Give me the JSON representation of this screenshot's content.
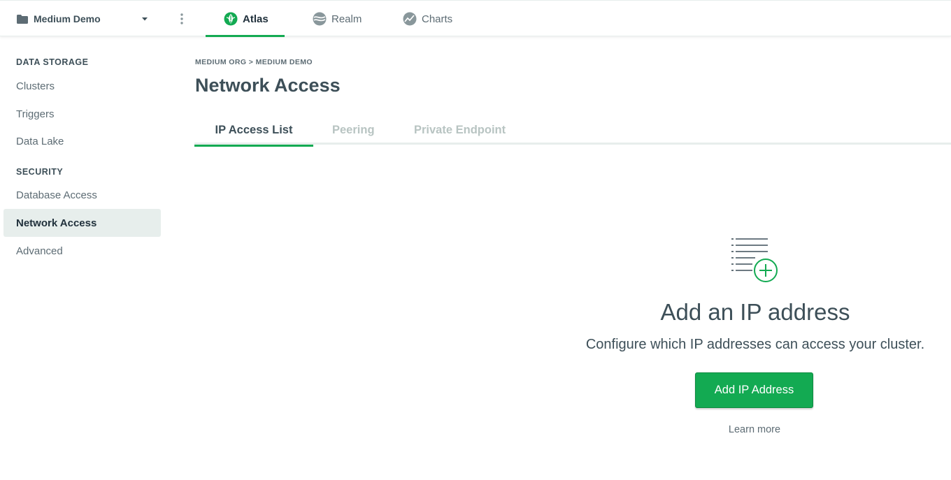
{
  "topbar": {
    "project_name": "Medium Demo",
    "tabs": [
      {
        "label": "Atlas",
        "icon": "atlas-leaf-icon"
      },
      {
        "label": "Realm",
        "icon": "realm-icon"
      },
      {
        "label": "Charts",
        "icon": "charts-icon"
      }
    ],
    "active_tab": "Atlas"
  },
  "sidebar": {
    "sections": [
      {
        "header": "DATA STORAGE",
        "items": [
          "Clusters",
          "Triggers",
          "Data Lake"
        ]
      },
      {
        "header": "SECURITY",
        "items": [
          "Database Access",
          "Network Access",
          "Advanced"
        ]
      }
    ],
    "active_item": "Network Access"
  },
  "main": {
    "breadcrumb": "MEDIUM ORG > MEDIUM DEMO",
    "title": "Network Access",
    "tabs": [
      "IP Access List",
      "Peering",
      "Private Endpoint"
    ],
    "active_tab": "IP Access List",
    "empty_state": {
      "icon": "list-add-icon",
      "title": "Add an IP address",
      "description": "Configure which IP addresses can access your cluster.",
      "button_label": "Add IP Address",
      "link_label": "Learn more"
    }
  },
  "colors": {
    "accent": "#13aa52",
    "text": "#3d4f58",
    "muted": "#b8c4c2",
    "active_bg": "#e7eeec"
  }
}
